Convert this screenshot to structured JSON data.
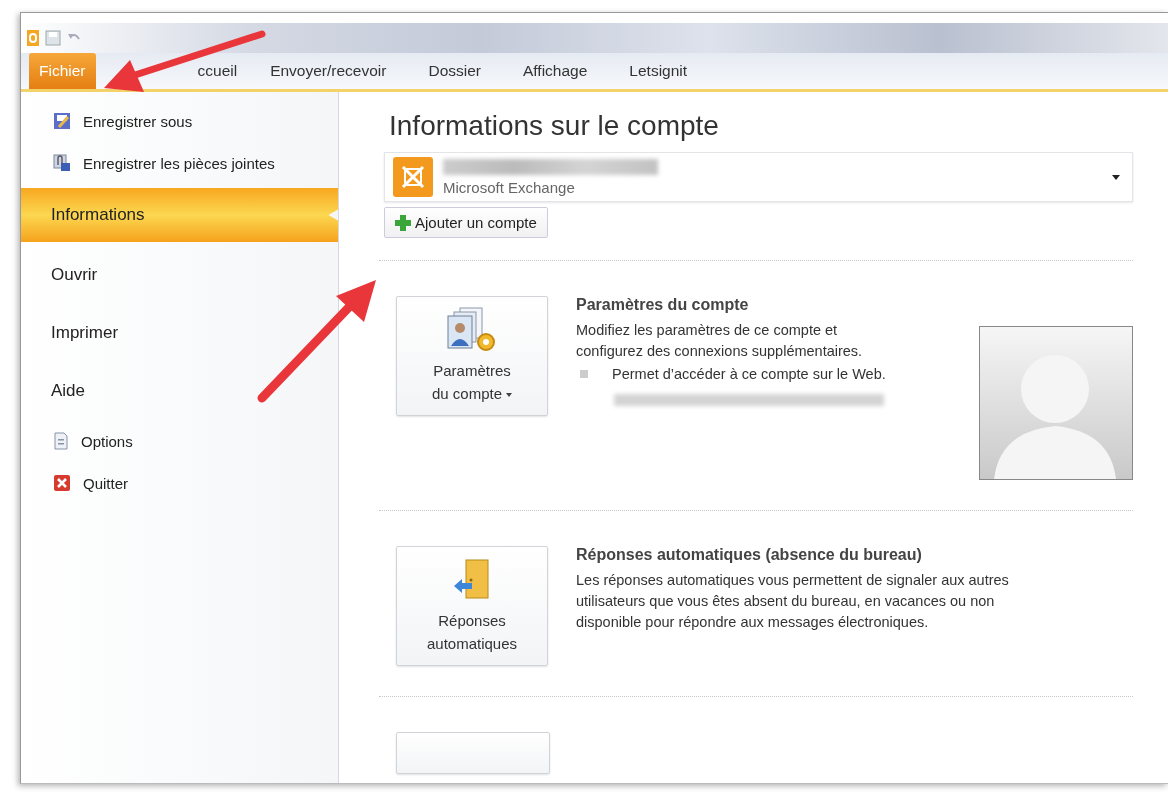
{
  "tabs": [
    {
      "label": "Fichier",
      "selected": true
    },
    {
      "label": "ccueil",
      "selected": false
    },
    {
      "label": "Envoyer/recevoir",
      "selected": false
    },
    {
      "label": "Dossier",
      "selected": false
    },
    {
      "label": "Affichage",
      "selected": false
    },
    {
      "label": "Letsignit",
      "selected": false
    }
  ],
  "sidebar": {
    "items": [
      {
        "label": "Enregistrer sous",
        "kind": "command",
        "selected": false
      },
      {
        "label": "Enregistrer les pièces jointes",
        "kind": "command",
        "selected": false
      },
      {
        "label": "Informations",
        "kind": "page",
        "selected": true
      },
      {
        "label": "Ouvrir",
        "kind": "page",
        "selected": false
      },
      {
        "label": "Imprimer",
        "kind": "page",
        "selected": false
      },
      {
        "label": "Aide",
        "kind": "page",
        "selected": false
      },
      {
        "label": "Options",
        "kind": "command",
        "selected": false
      },
      {
        "label": "Quitter",
        "kind": "command",
        "selected": false
      }
    ]
  },
  "title": "Informations sur le compte",
  "account": {
    "type": "Microsoft Exchange"
  },
  "add_account_button": "Ajouter un compte",
  "sections": [
    {
      "button_label": "Paramètres du compte",
      "has_dropdown": true,
      "title": "Paramètres du compte",
      "description": "Modifiez les paramètres de ce compte et configurez des connexions supplémentaires.",
      "bullet": "Permet d’accéder à ce compte sur le Web.",
      "picture": true
    },
    {
      "button_label": "Réponses automatiques",
      "has_dropdown": false,
      "title": "Réponses automatiques (absence du bureau)",
      "description": "Les réponses automatiques vous permettent de signaler aux autres utilisateurs que vous êtes absent du bureau, en vacances ou non disponible pour répondre aux messages électroniques.",
      "picture": false
    }
  ]
}
